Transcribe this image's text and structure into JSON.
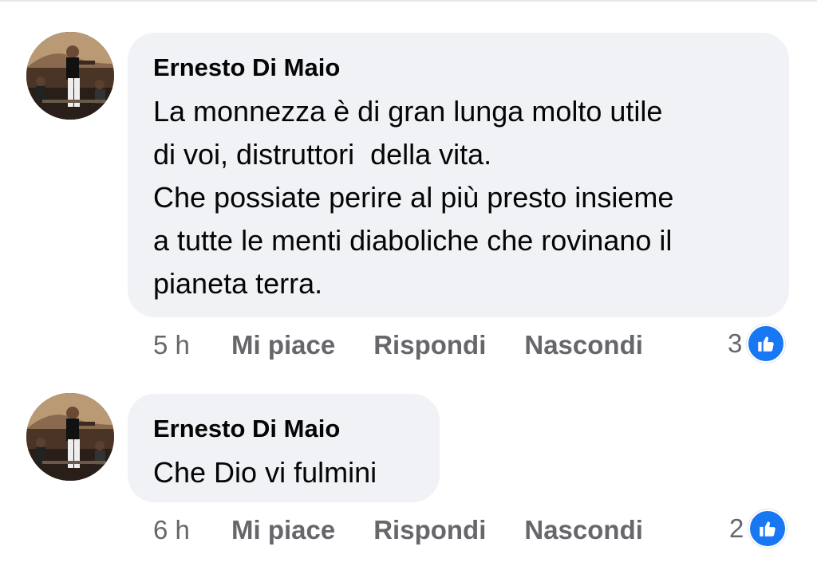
{
  "comments": [
    {
      "author": "Ernesto Di Maio",
      "text": "La monnezza è di gran lunga molto utile\ndi voi, distruttori  della vita.\nChe possiate perire al più presto insieme\na tutte le menti diaboliche che rovinano il\npianeta terra.",
      "time": "5 h",
      "like_label": "Mi piace",
      "reply_label": "Rispondi",
      "hide_label": "Nascondi",
      "reaction_count": "3",
      "reaction_icon": "like-icon"
    },
    {
      "author": "Ernesto Di Maio",
      "text": "Che Dio vi fulmini",
      "time": "6 h",
      "like_label": "Mi piace",
      "reply_label": "Rispondi",
      "hide_label": "Nascondi",
      "reaction_count": "2",
      "reaction_icon": "like-icon"
    }
  ],
  "colors": {
    "bubble_bg": "#f0f2f5",
    "secondary_text": "#65676b",
    "like_blue": "#1877f2"
  }
}
